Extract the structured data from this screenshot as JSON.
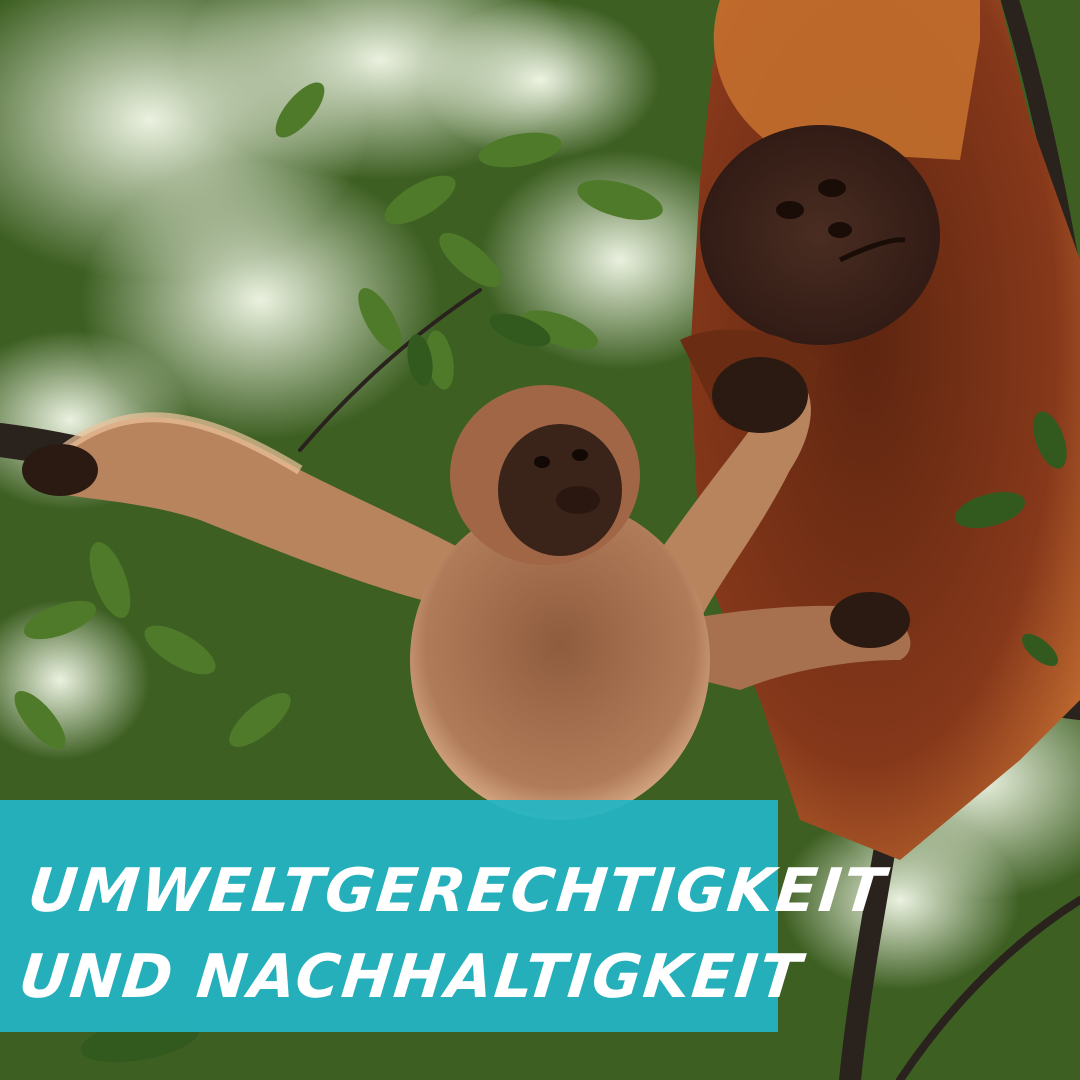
{
  "image": {
    "subject": "orangutan-mother-and-infant",
    "colors": {
      "foliage_dark": "#2f4a1c",
      "foliage_mid": "#4f7a2a",
      "foliage_light": "#8cb55a",
      "sky_glow": "#eef5e4",
      "fur_adult": "#8a3b17",
      "fur_adult_light": "#c76a2c",
      "fur_infant": "#a7704f",
      "fur_infant_glow": "#e2b48d",
      "face": "#3a2319",
      "branch": "#2a231d",
      "banner": "#23b5c3",
      "banner_text": "#ffffff"
    }
  },
  "banner": {
    "line1": "UMWELTGERECHTIGKEIT",
    "line2": "UND NACHHALTIGKEIT"
  }
}
